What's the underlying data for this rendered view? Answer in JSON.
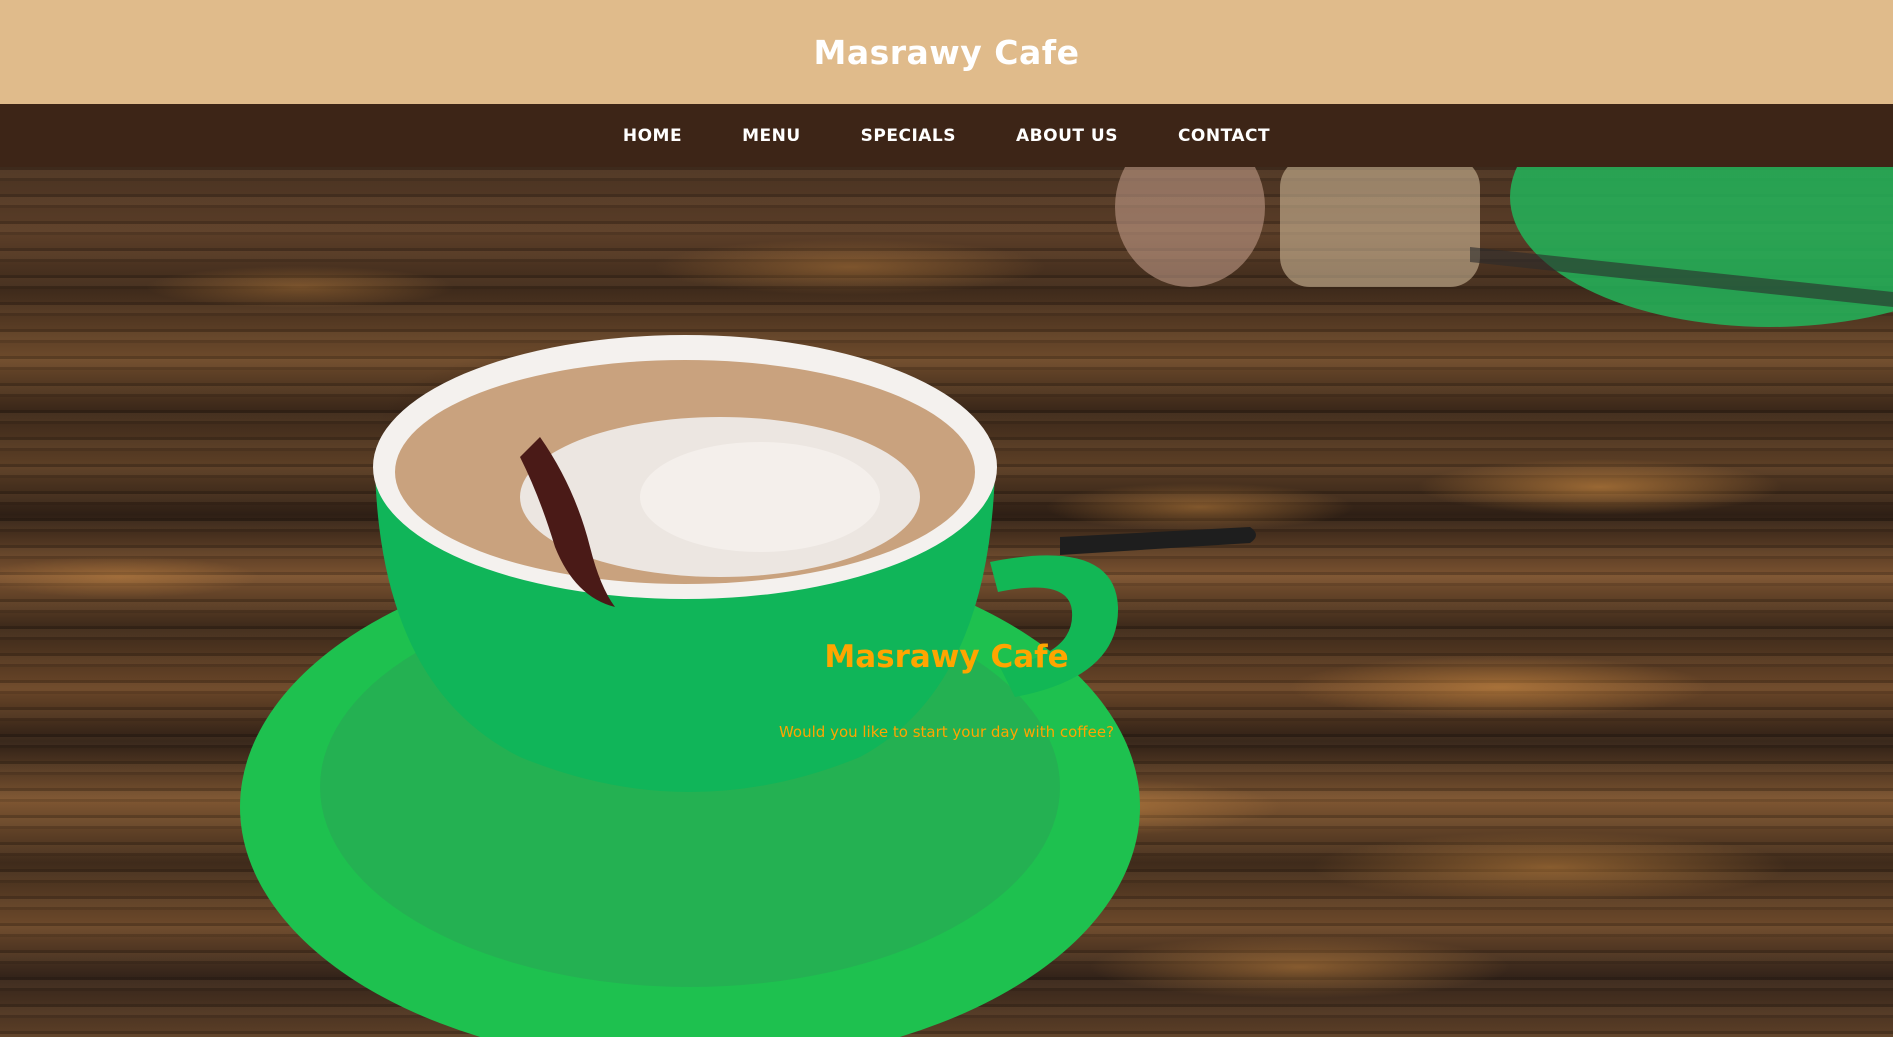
{
  "header": {
    "title": "Masrawy Cafe"
  },
  "nav": {
    "items": [
      {
        "label": "HOME"
      },
      {
        "label": "MENU"
      },
      {
        "label": "SPECIALS"
      },
      {
        "label": "ABOUT US"
      },
      {
        "label": "CONTACT"
      }
    ]
  },
  "hero": {
    "title": "Masrawy Cafe",
    "subtitle": "Would you like to start your day with coffee?",
    "image_subject": "green-coffee-cup-on-wooden-table"
  },
  "colors": {
    "header_bg": "#e0bb8b",
    "nav_bg": "#3d2517",
    "hero_text": "#ffa500",
    "header_text": "#ffffff"
  }
}
